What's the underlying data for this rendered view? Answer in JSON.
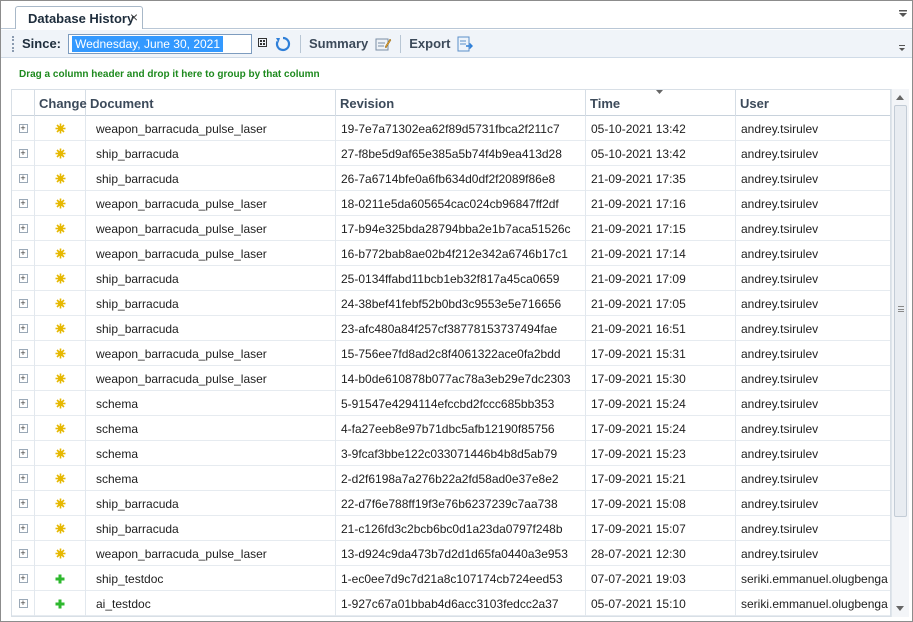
{
  "tab": {
    "title": "Database History",
    "close": "×"
  },
  "toolbar": {
    "since_label": "Since:",
    "date_value": "Wednesday, June 30, 2021",
    "summary_label": "Summary",
    "export_label": "Export"
  },
  "group_panel": {
    "hint": "Drag a column header and drop it here to group by that column"
  },
  "columns": {
    "change": "Change",
    "document": "Document",
    "revision": "Revision",
    "time": "Time",
    "user": "User"
  },
  "icons": {
    "modified": "modified-change-icon",
    "added": "added-change-icon",
    "modified_color": "#e6b800",
    "added_color": "#2eb82e"
  },
  "rows": [
    {
      "type": "modified",
      "document": "weapon_barracuda_pulse_laser",
      "revision": "19-7e7a71302ea62f89d5731fbca2f211c7",
      "time": "05-10-2021 13:42",
      "user": "andrey.tsirulev"
    },
    {
      "type": "modified",
      "document": "ship_barracuda",
      "revision": "27-f8be5d9af65e385a5b74f4b9ea413d28",
      "time": "05-10-2021 13:42",
      "user": "andrey.tsirulev"
    },
    {
      "type": "modified",
      "document": "ship_barracuda",
      "revision": "26-7a6714bfe0a6fb634d0df2f2089f86e8",
      "time": "21-09-2021 17:35",
      "user": "andrey.tsirulev"
    },
    {
      "type": "modified",
      "document": "weapon_barracuda_pulse_laser",
      "revision": "18-0211e5da605654cac024cb96847ff2df",
      "time": "21-09-2021 17:16",
      "user": "andrey.tsirulev"
    },
    {
      "type": "modified",
      "document": "weapon_barracuda_pulse_laser",
      "revision": "17-b94e325bda28794bba2e1b7aca51526c",
      "time": "21-09-2021 17:15",
      "user": "andrey.tsirulev"
    },
    {
      "type": "modified",
      "document": "weapon_barracuda_pulse_laser",
      "revision": "16-b772bab8ae02b4f212e342a6746b17c1",
      "time": "21-09-2021 17:14",
      "user": "andrey.tsirulev"
    },
    {
      "type": "modified",
      "document": "ship_barracuda",
      "revision": "25-0134ffabd11bcb1eb32f817a45ca0659",
      "time": "21-09-2021 17:09",
      "user": "andrey.tsirulev"
    },
    {
      "type": "modified",
      "document": "ship_barracuda",
      "revision": "24-38bef41febf52b0bd3c9553e5e716656",
      "time": "21-09-2021 17:05",
      "user": "andrey.tsirulev"
    },
    {
      "type": "modified",
      "document": "ship_barracuda",
      "revision": "23-afc480a84f257cf38778153737494fae",
      "time": "21-09-2021 16:51",
      "user": "andrey.tsirulev"
    },
    {
      "type": "modified",
      "document": "weapon_barracuda_pulse_laser",
      "revision": "15-756ee7fd8ad2c8f4061322ace0fa2bdd",
      "time": "17-09-2021 15:31",
      "user": "andrey.tsirulev"
    },
    {
      "type": "modified",
      "document": "weapon_barracuda_pulse_laser",
      "revision": "14-b0de610878b077ac78a3eb29e7dc2303",
      "time": "17-09-2021 15:30",
      "user": "andrey.tsirulev"
    },
    {
      "type": "modified",
      "document": "schema",
      "revision": "5-91547e4294114efccbd2fccc685bb353",
      "time": "17-09-2021 15:24",
      "user": "andrey.tsirulev"
    },
    {
      "type": "modified",
      "document": "schema",
      "revision": "4-fa27eeb8e97b71dbc5afb12190f85756",
      "time": "17-09-2021 15:24",
      "user": "andrey.tsirulev"
    },
    {
      "type": "modified",
      "document": "schema",
      "revision": "3-9fcaf3bbe122c033071446b4b8d5ab79",
      "time": "17-09-2021 15:23",
      "user": "andrey.tsirulev"
    },
    {
      "type": "modified",
      "document": "schema",
      "revision": "2-d2f6198a7a276b22a2fd58ad0e37e8e2",
      "time": "17-09-2021 15:21",
      "user": "andrey.tsirulev"
    },
    {
      "type": "modified",
      "document": "ship_barracuda",
      "revision": "22-d7f6e788ff19f3e76b6237239c7aa738",
      "time": "17-09-2021 15:08",
      "user": "andrey.tsirulev"
    },
    {
      "type": "modified",
      "document": "ship_barracuda",
      "revision": "21-c126fd3c2bcb6bc0d1a23da0797f248b",
      "time": "17-09-2021 15:07",
      "user": "andrey.tsirulev"
    },
    {
      "type": "modified",
      "document": "weapon_barracuda_pulse_laser",
      "revision": "13-d924c9da473b7d2d1d65fa0440a3e953",
      "time": "28-07-2021 12:30",
      "user": "andrey.tsirulev"
    },
    {
      "type": "added",
      "document": "ship_testdoc",
      "revision": "1-ec0ee7d9c7d21a8c107174cb724eed53",
      "time": "07-07-2021 19:03",
      "user": "seriki.emmanuel.olugbenga"
    },
    {
      "type": "added",
      "document": "ai_testdoc",
      "revision": "1-927c67a01bbab4d6acc3103fedcc2a37",
      "time": "05-07-2021 15:10",
      "user": "seriki.emmanuel.olugbenga"
    }
  ]
}
